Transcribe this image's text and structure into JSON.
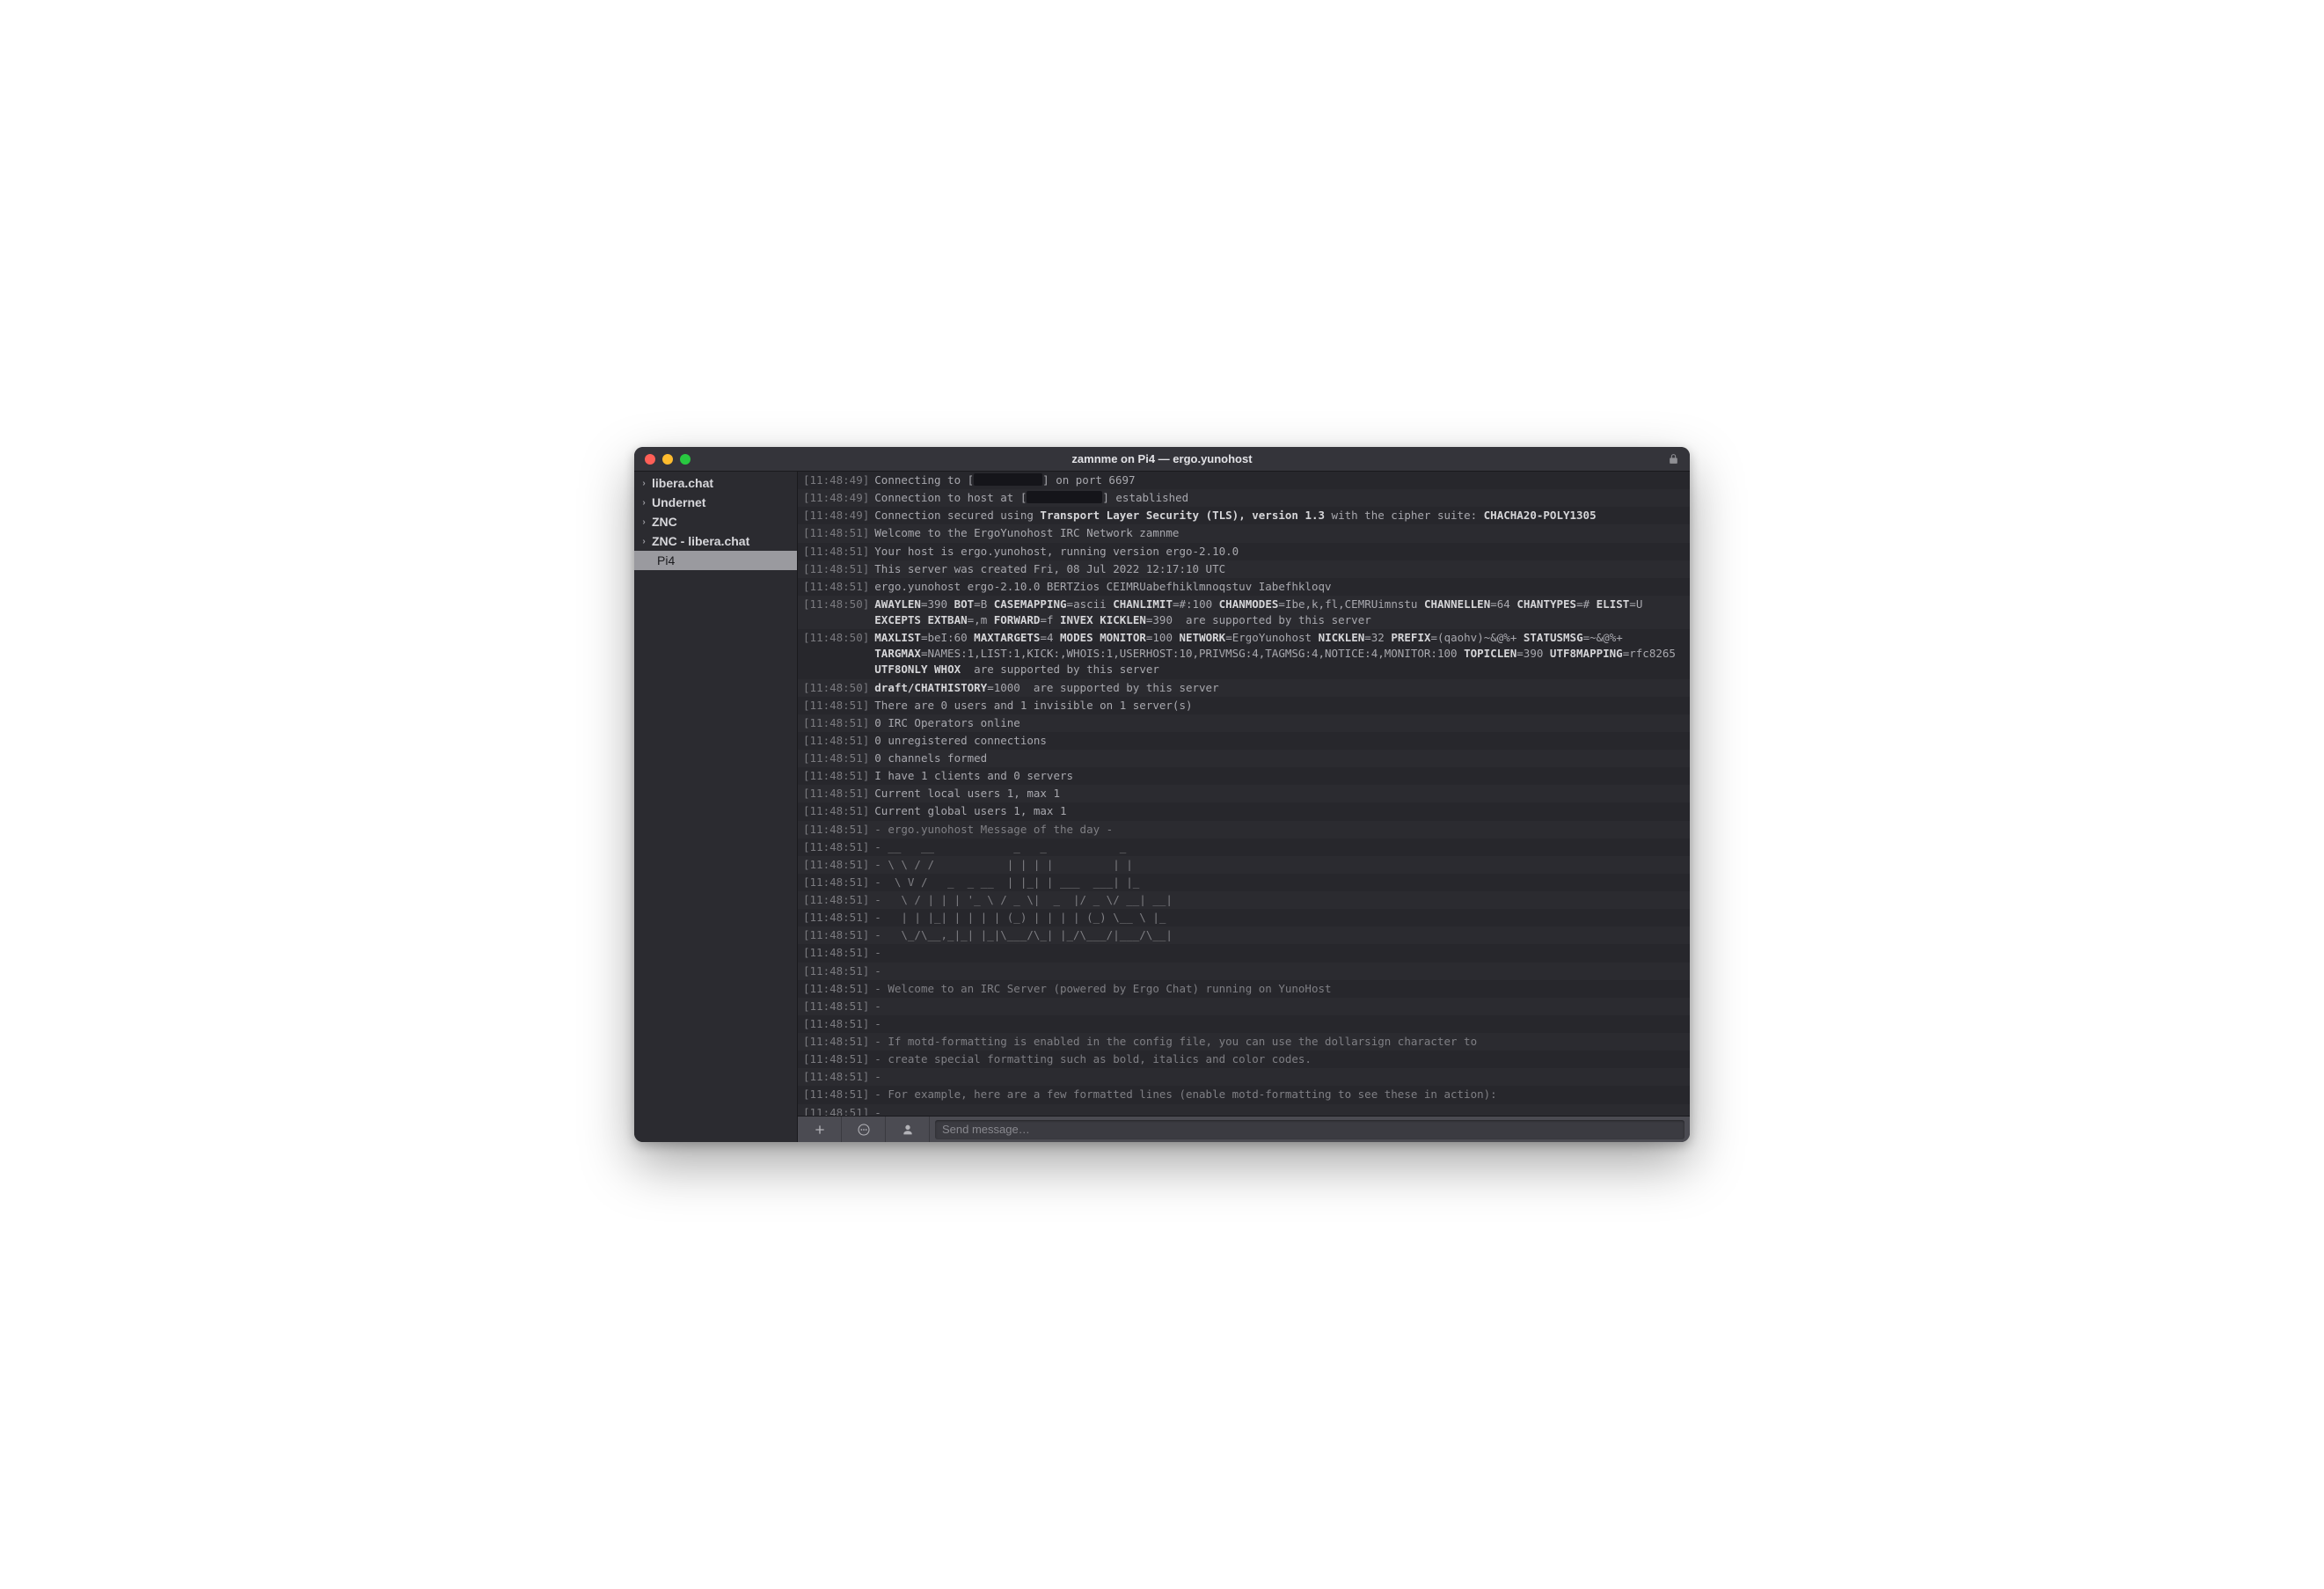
{
  "window_title": "zamnme on Pi4 — ergo.yunohost",
  "input_placeholder": "Send message…",
  "sidebar": {
    "items": [
      {
        "label": "libera.chat",
        "expandable": true
      },
      {
        "label": "Undernet",
        "expandable": true
      },
      {
        "label": "ZNC",
        "expandable": true
      },
      {
        "label": "ZNC - libera.chat",
        "expandable": true
      },
      {
        "label": "Pi4",
        "expandable": false,
        "selected": true,
        "child": true
      }
    ]
  },
  "messages": [
    {
      "ts": "[11:48:49]",
      "segments": [
        {
          "t": "Connecting to ["
        },
        {
          "type": "redacted",
          "w": 78
        },
        {
          "t": "] on port 6697"
        }
      ]
    },
    {
      "ts": "[11:48:49]",
      "segments": [
        {
          "t": "Connection to host at ["
        },
        {
          "type": "redacted",
          "w": 86
        },
        {
          "t": "] established"
        }
      ]
    },
    {
      "ts": "[11:48:49]",
      "segments": [
        {
          "t": "Connection secured using "
        },
        {
          "t": "Transport Layer Security (TLS), version 1.3",
          "b": true
        },
        {
          "t": " with the cipher suite: "
        },
        {
          "t": "CHACHA20-POLY1305",
          "b": true
        }
      ]
    },
    {
      "ts": "[11:48:51]",
      "segments": [
        {
          "t": "Welcome to the ErgoYunohost IRC Network zamnme"
        }
      ]
    },
    {
      "ts": "[11:48:51]",
      "segments": [
        {
          "t": "Your host is ergo.yunohost, running version ergo-2.10.0"
        }
      ]
    },
    {
      "ts": "[11:48:51]",
      "segments": [
        {
          "t": "This server was created Fri, 08 Jul 2022 12:17:10 UTC"
        }
      ]
    },
    {
      "ts": "[11:48:51]",
      "segments": [
        {
          "t": "ergo.yunohost ergo-2.10.0 BERTZios CEIMRUabefhiklmnoqstuv Iabefhkloqv"
        }
      ]
    },
    {
      "ts": "[11:48:50]",
      "segments": [
        {
          "t": "AWAYLEN",
          "b": true
        },
        {
          "t": "=390 "
        },
        {
          "t": "BOT",
          "b": true
        },
        {
          "t": "=B "
        },
        {
          "t": "CASEMAPPING",
          "b": true
        },
        {
          "t": "=ascii "
        },
        {
          "t": "CHANLIMIT",
          "b": true
        },
        {
          "t": "=#:100 "
        },
        {
          "t": "CHANMODES",
          "b": true
        },
        {
          "t": "=Ibe,k,fl,CEMRUimnstu "
        },
        {
          "t": "CHANNELLEN",
          "b": true
        },
        {
          "t": "=64 "
        },
        {
          "t": "CHANTYPES",
          "b": true
        },
        {
          "t": "=# "
        },
        {
          "t": "ELIST",
          "b": true
        },
        {
          "t": "=U "
        },
        {
          "t": "EXCEPTS",
          "b": true
        },
        {
          "t": " "
        },
        {
          "t": "EXTBAN",
          "b": true
        },
        {
          "t": "=,m "
        },
        {
          "t": "FORWARD",
          "b": true
        },
        {
          "t": "=f "
        },
        {
          "t": "INVEX",
          "b": true
        },
        {
          "t": " "
        },
        {
          "t": "KICKLEN",
          "b": true
        },
        {
          "t": "=390  are supported by this server"
        }
      ]
    },
    {
      "ts": "[11:48:50]",
      "segments": [
        {
          "t": "MAXLIST",
          "b": true
        },
        {
          "t": "=beI:60 "
        },
        {
          "t": "MAXTARGETS",
          "b": true
        },
        {
          "t": "=4 "
        },
        {
          "t": "MODES",
          "b": true
        },
        {
          "t": " "
        },
        {
          "t": "MONITOR",
          "b": true
        },
        {
          "t": "=100 "
        },
        {
          "t": "NETWORK",
          "b": true
        },
        {
          "t": "=ErgoYunohost "
        },
        {
          "t": "NICKLEN",
          "b": true
        },
        {
          "t": "=32 "
        },
        {
          "t": "PREFIX",
          "b": true
        },
        {
          "t": "=(qaohv)~&@%+ "
        },
        {
          "t": "STATUSMSG",
          "b": true
        },
        {
          "t": "=~&@%+ "
        },
        {
          "t": "TARGMAX",
          "b": true
        },
        {
          "t": "=NAMES:1,LIST:1,KICK:,WHOIS:1,USERHOST:10,PRIVMSG:4,TAGMSG:4,NOTICE:4,MONITOR:100 "
        },
        {
          "t": "TOPICLEN",
          "b": true
        },
        {
          "t": "=390 "
        },
        {
          "t": "UTF8MAPPING",
          "b": true
        },
        {
          "t": "=rfc8265 "
        },
        {
          "t": "UTF8ONLY",
          "b": true
        },
        {
          "t": " "
        },
        {
          "t": "WHOX",
          "b": true
        },
        {
          "t": "  are supported by this server"
        }
      ]
    },
    {
      "ts": "[11:48:50]",
      "segments": [
        {
          "t": "draft/CHATHISTORY",
          "b": true
        },
        {
          "t": "=1000  are supported by this server"
        }
      ]
    },
    {
      "ts": "[11:48:51]",
      "segments": [
        {
          "t": "There are 0 users and 1 invisible on 1 server(s)"
        }
      ]
    },
    {
      "ts": "[11:48:51]",
      "segments": [
        {
          "t": "0 IRC Operators online"
        }
      ]
    },
    {
      "ts": "[11:48:51]",
      "segments": [
        {
          "t": "0 unregistered connections"
        }
      ]
    },
    {
      "ts": "[11:48:51]",
      "segments": [
        {
          "t": "0 channels formed"
        }
      ]
    },
    {
      "ts": "[11:48:51]",
      "segments": [
        {
          "t": "I have 1 clients and 0 servers"
        }
      ]
    },
    {
      "ts": "[11:48:51]",
      "segments": [
        {
          "t": "Current local users 1, max 1"
        }
      ]
    },
    {
      "ts": "[11:48:51]",
      "segments": [
        {
          "t": "Current global users 1, max 1"
        }
      ]
    },
    {
      "ts": "[11:48:51]",
      "motd": true,
      "segments": [
        {
          "t": "- ergo.yunohost Message of the day -"
        }
      ]
    },
    {
      "ts": "[11:48:51]",
      "motd": true,
      "segments": [
        {
          "t": "- __   __            _   _           _"
        }
      ]
    },
    {
      "ts": "[11:48:51]",
      "motd": true,
      "segments": [
        {
          "t": "- \\ \\ / /           | | | |         | |"
        }
      ]
    },
    {
      "ts": "[11:48:51]",
      "motd": true,
      "segments": [
        {
          "t": "-  \\ V /   _  _ __  | |_| | ___  ___| |_"
        }
      ]
    },
    {
      "ts": "[11:48:51]",
      "motd": true,
      "segments": [
        {
          "t": "-   \\ / | | | '_ \\ / _ \\|  _  |/ _ \\/ __| __|"
        }
      ]
    },
    {
      "ts": "[11:48:51]",
      "motd": true,
      "segments": [
        {
          "t": "-   | | |_| | | | | (_) | | | | (_) \\__ \\ |_"
        }
      ]
    },
    {
      "ts": "[11:48:51]",
      "motd": true,
      "segments": [
        {
          "t": "-   \\_/\\__,_|_| |_|\\___/\\_| |_/\\___/|___/\\__|"
        }
      ]
    },
    {
      "ts": "[11:48:51]",
      "motd": true,
      "segments": [
        {
          "t": "-"
        }
      ]
    },
    {
      "ts": "[11:48:51]",
      "motd": true,
      "segments": [
        {
          "t": "-"
        }
      ]
    },
    {
      "ts": "[11:48:51]",
      "motd": true,
      "segments": [
        {
          "t": "- Welcome to an IRC Server (powered by Ergo Chat) running on YunoHost"
        }
      ]
    },
    {
      "ts": "[11:48:51]",
      "motd": true,
      "segments": [
        {
          "t": "-"
        }
      ]
    },
    {
      "ts": "[11:48:51]",
      "motd": true,
      "segments": [
        {
          "t": "-"
        }
      ]
    },
    {
      "ts": "[11:48:51]",
      "motd": true,
      "segments": [
        {
          "t": "- If motd-formatting is enabled in the config file, you can use the dollarsign character to"
        }
      ]
    },
    {
      "ts": "[11:48:51]",
      "motd": true,
      "segments": [
        {
          "t": "- create special formatting such as bold, italics and color codes."
        }
      ]
    },
    {
      "ts": "[11:48:51]",
      "motd": true,
      "segments": [
        {
          "t": "-"
        }
      ]
    },
    {
      "ts": "[11:48:51]",
      "motd": true,
      "segments": [
        {
          "t": "- For example, here are a few formatted lines (enable motd-formatting to see these in action):"
        }
      ]
    },
    {
      "ts": "[11:48:51]",
      "motd": true,
      "segments": [
        {
          "t": "-"
        }
      ]
    }
  ]
}
